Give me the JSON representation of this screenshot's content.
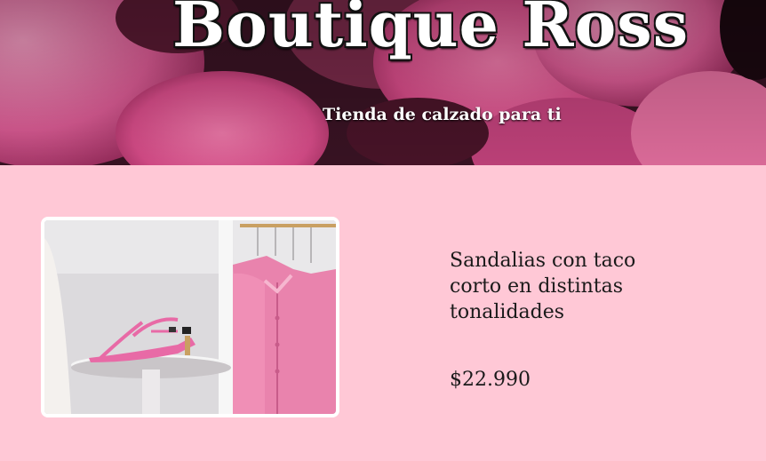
{
  "header": {
    "title": "Boutique Ross",
    "subtitle": "Tienda de calzado para ti",
    "background_image": "pink-flowers-photo"
  },
  "product": {
    "image": "pink-sandals-and-cardigan-photo",
    "name": "Sandalias con taco corto en distintas tonalidades",
    "price": "$22.990"
  },
  "colors": {
    "page_background": "#ffc8d6",
    "hero_dark": "#2a0d18",
    "petal_pink": "#e2548f",
    "text_dark": "#1a1a1a",
    "title_white": "#ffffff"
  }
}
